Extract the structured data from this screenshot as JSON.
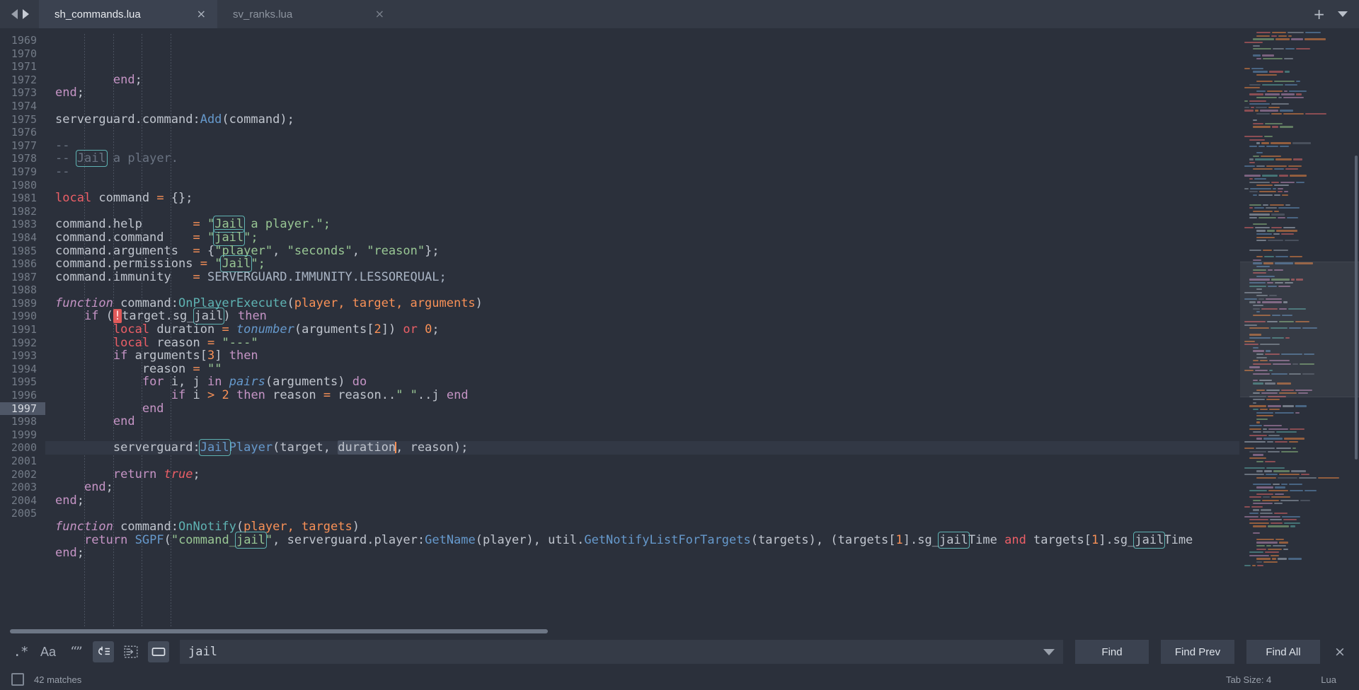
{
  "window": {
    "tabs": [
      {
        "label": "sh_commands.lua",
        "active": true,
        "close": "×"
      },
      {
        "label": "sv_ranks.lua",
        "active": false,
        "close": "×"
      }
    ],
    "nav_back": "nav-back",
    "nav_forward": "nav-forward",
    "new_tab": "+",
    "tab_menu": "tab-list-chevron"
  },
  "editor": {
    "first_line": 1969,
    "current_line": 1997,
    "lines": [
      {
        "n": 1969,
        "indent": 2,
        "tokens": [
          {
            "t": "        ",
            "c": "t-def"
          },
          {
            "t": "end",
            "c": "t-kw2"
          },
          {
            "t": ";",
            "c": "t-punc"
          }
        ]
      },
      {
        "n": 1970,
        "indent": 0,
        "tokens": [
          {
            "t": "end",
            "c": "t-kw2"
          },
          {
            "t": ";",
            "c": "t-punc"
          }
        ]
      },
      {
        "n": 1971,
        "indent": 0,
        "tokens": []
      },
      {
        "n": 1972,
        "indent": 0,
        "tokens": [
          {
            "t": "serverguard.command:",
            "c": "t-def"
          },
          {
            "t": "Add",
            "c": "t-fn2"
          },
          {
            "t": "(",
            "c": "t-punc"
          },
          {
            "t": "command",
            "c": "t-def"
          },
          {
            "t": ");",
            "c": "t-punc"
          }
        ]
      },
      {
        "n": 1973,
        "indent": 0,
        "tokens": []
      },
      {
        "n": 1974,
        "indent": 0,
        "tokens": [
          {
            "t": "--",
            "c": "t-com"
          }
        ]
      },
      {
        "n": 1975,
        "indent": 0,
        "tokens": [
          {
            "t": "-- ",
            "c": "t-com"
          },
          {
            "t": "Jail",
            "c": "t-com",
            "hit": true
          },
          {
            "t": " a player.",
            "c": "t-com"
          }
        ]
      },
      {
        "n": 1976,
        "indent": 0,
        "tokens": [
          {
            "t": "--",
            "c": "t-com"
          }
        ]
      },
      {
        "n": 1977,
        "indent": 0,
        "tokens": []
      },
      {
        "n": 1978,
        "indent": 0,
        "tokens": [
          {
            "t": "local",
            "c": "t-kw"
          },
          {
            "t": " command ",
            "c": "t-def"
          },
          {
            "t": "=",
            "c": "t-op"
          },
          {
            "t": " {};",
            "c": "t-punc"
          }
        ]
      },
      {
        "n": 1979,
        "indent": 0,
        "tokens": []
      },
      {
        "n": 1980,
        "indent": 0,
        "tokens": [
          {
            "t": "command.help       ",
            "c": "t-def"
          },
          {
            "t": "=",
            "c": "t-op"
          },
          {
            "t": " \"",
            "c": "t-str"
          },
          {
            "t": "Jail",
            "c": "t-str",
            "hit": true
          },
          {
            "t": " a player.\";",
            "c": "t-str"
          }
        ]
      },
      {
        "n": 1981,
        "indent": 0,
        "tokens": [
          {
            "t": "command.command    ",
            "c": "t-def"
          },
          {
            "t": "=",
            "c": "t-op"
          },
          {
            "t": " \"",
            "c": "t-str"
          },
          {
            "t": "jail",
            "c": "t-str",
            "hit": true
          },
          {
            "t": "\";",
            "c": "t-str"
          }
        ]
      },
      {
        "n": 1982,
        "indent": 0,
        "tokens": [
          {
            "t": "command.arguments  ",
            "c": "t-def"
          },
          {
            "t": "=",
            "c": "t-op"
          },
          {
            "t": " {",
            "c": "t-punc"
          },
          {
            "t": "\"player\"",
            "c": "t-str"
          },
          {
            "t": ", ",
            "c": "t-punc"
          },
          {
            "t": "\"seconds\"",
            "c": "t-str"
          },
          {
            "t": ", ",
            "c": "t-punc"
          },
          {
            "t": "\"reason\"",
            "c": "t-str"
          },
          {
            "t": "};",
            "c": "t-punc"
          }
        ]
      },
      {
        "n": 1983,
        "indent": 0,
        "tokens": [
          {
            "t": "command.permissions ",
            "c": "t-def"
          },
          {
            "t": "=",
            "c": "t-op"
          },
          {
            "t": " \"",
            "c": "t-str"
          },
          {
            "t": "Jail",
            "c": "t-str",
            "hit": true
          },
          {
            "t": "\";",
            "c": "t-str"
          }
        ]
      },
      {
        "n": 1984,
        "indent": 0,
        "tokens": [
          {
            "t": "command.immunity   ",
            "c": "t-def"
          },
          {
            "t": "=",
            "c": "t-op"
          },
          {
            "t": " SERVERGUARD.IMMUNITY.LESSOREQUAL;",
            "c": "t-up"
          }
        ]
      },
      {
        "n": 1985,
        "indent": 0,
        "tokens": []
      },
      {
        "n": 1986,
        "indent": 0,
        "tokens": [
          {
            "t": "function",
            "c": "t-itmag"
          },
          {
            "t": " command:",
            "c": "t-def"
          },
          {
            "t": "OnPlayerExecute",
            "c": "t-fn"
          },
          {
            "t": "(",
            "c": "t-punc"
          },
          {
            "t": "player, target, arguments",
            "c": "t-par"
          },
          {
            "t": ")",
            "c": "t-punc"
          }
        ]
      },
      {
        "n": 1987,
        "indent": 1,
        "tokens": [
          {
            "t": "    ",
            "c": "t-def"
          },
          {
            "t": "if",
            "c": "t-kw2"
          },
          {
            "t": " (",
            "c": "t-punc"
          },
          {
            "t": "!",
            "c": "t-def",
            "err": true
          },
          {
            "t": "target.sg_",
            "c": "t-def"
          },
          {
            "t": "jail",
            "c": "t-def",
            "hit": true
          },
          {
            "t": ") ",
            "c": "t-punc"
          },
          {
            "t": "then",
            "c": "t-kw2"
          }
        ]
      },
      {
        "n": 1988,
        "indent": 2,
        "tokens": [
          {
            "t": "        ",
            "c": "t-def"
          },
          {
            "t": "local",
            "c": "t-kw"
          },
          {
            "t": " duration ",
            "c": "t-def"
          },
          {
            "t": "=",
            "c": "t-op"
          },
          {
            "t": " ",
            "c": "t-def"
          },
          {
            "t": "tonumber",
            "c": "t-fnit"
          },
          {
            "t": "(",
            "c": "t-punc"
          },
          {
            "t": "arguments",
            "c": "t-def"
          },
          {
            "t": "[",
            "c": "t-punc"
          },
          {
            "t": "2",
            "c": "t-num"
          },
          {
            "t": "]) ",
            "c": "t-punc"
          },
          {
            "t": "or",
            "c": "t-kw"
          },
          {
            "t": " ",
            "c": "t-def"
          },
          {
            "t": "0",
            "c": "t-num"
          },
          {
            "t": ";",
            "c": "t-punc"
          }
        ]
      },
      {
        "n": 1989,
        "indent": 2,
        "tokens": [
          {
            "t": "        ",
            "c": "t-def"
          },
          {
            "t": "local",
            "c": "t-kw"
          },
          {
            "t": " reason ",
            "c": "t-def"
          },
          {
            "t": "=",
            "c": "t-op"
          },
          {
            "t": " \"---\"",
            "c": "t-str"
          }
        ]
      },
      {
        "n": 1990,
        "indent": 2,
        "tokens": [
          {
            "t": "        ",
            "c": "t-def"
          },
          {
            "t": "if",
            "c": "t-kw2"
          },
          {
            "t": " arguments",
            "c": "t-def"
          },
          {
            "t": "[",
            "c": "t-punc"
          },
          {
            "t": "3",
            "c": "t-num"
          },
          {
            "t": "] ",
            "c": "t-punc"
          },
          {
            "t": "then",
            "c": "t-kw2"
          }
        ]
      },
      {
        "n": 1991,
        "indent": 3,
        "tokens": [
          {
            "t": "            reason ",
            "c": "t-def"
          },
          {
            "t": "=",
            "c": "t-op"
          },
          {
            "t": " \"\"",
            "c": "t-str"
          }
        ]
      },
      {
        "n": 1992,
        "indent": 3,
        "tokens": [
          {
            "t": "            ",
            "c": "t-def"
          },
          {
            "t": "for",
            "c": "t-kw2"
          },
          {
            "t": " i, j ",
            "c": "t-def"
          },
          {
            "t": "in",
            "c": "t-kw2"
          },
          {
            "t": " ",
            "c": "t-def"
          },
          {
            "t": "pairs",
            "c": "t-fnit"
          },
          {
            "t": "(",
            "c": "t-punc"
          },
          {
            "t": "arguments",
            "c": "t-def"
          },
          {
            "t": ") ",
            "c": "t-punc"
          },
          {
            "t": "do",
            "c": "t-kw2"
          }
        ]
      },
      {
        "n": 1993,
        "indent": 4,
        "tokens": [
          {
            "t": "                ",
            "c": "t-def"
          },
          {
            "t": "if",
            "c": "t-kw2"
          },
          {
            "t": " i ",
            "c": "t-def"
          },
          {
            "t": ">",
            "c": "t-op"
          },
          {
            "t": " ",
            "c": "t-def"
          },
          {
            "t": "2",
            "c": "t-num"
          },
          {
            "t": " ",
            "c": "t-def"
          },
          {
            "t": "then",
            "c": "t-kw2"
          },
          {
            "t": " reason ",
            "c": "t-def"
          },
          {
            "t": "=",
            "c": "t-op"
          },
          {
            "t": " reason..",
            "c": "t-def"
          },
          {
            "t": "\" \"",
            "c": "t-str"
          },
          {
            "t": "..j ",
            "c": "t-def"
          },
          {
            "t": "end",
            "c": "t-kw2"
          }
        ]
      },
      {
        "n": 1994,
        "indent": 3,
        "tokens": [
          {
            "t": "            ",
            "c": "t-def"
          },
          {
            "t": "end",
            "c": "t-kw2"
          }
        ]
      },
      {
        "n": 1995,
        "indent": 2,
        "tokens": [
          {
            "t": "        ",
            "c": "t-def"
          },
          {
            "t": "end",
            "c": "t-kw2"
          }
        ]
      },
      {
        "n": 1996,
        "indent": 2,
        "tokens": []
      },
      {
        "n": 1997,
        "indent": 2,
        "current": true,
        "tokens": [
          {
            "t": "        serverguard:",
            "c": "t-def"
          },
          {
            "t": "Jail",
            "c": "t-fn2",
            "hit": true
          },
          {
            "t": "Player",
            "c": "t-fn2"
          },
          {
            "t": "(",
            "c": "t-punc"
          },
          {
            "t": "target, ",
            "c": "t-def"
          },
          {
            "t": "duration",
            "c": "t-def",
            "sel": true
          },
          {
            "t": "",
            "c": "t-def",
            "caret": true
          },
          {
            "t": ", reason);",
            "c": "t-def"
          }
        ]
      },
      {
        "n": 1998,
        "indent": 2,
        "tokens": []
      },
      {
        "n": 1999,
        "indent": 2,
        "tokens": [
          {
            "t": "        ",
            "c": "t-def"
          },
          {
            "t": "return",
            "c": "t-kw2"
          },
          {
            "t": " ",
            "c": "t-def"
          },
          {
            "t": "true",
            "c": "t-const"
          },
          {
            "t": ";",
            "c": "t-punc"
          }
        ]
      },
      {
        "n": 2000,
        "indent": 1,
        "tokens": [
          {
            "t": "    ",
            "c": "t-def"
          },
          {
            "t": "end",
            "c": "t-kw2"
          },
          {
            "t": ";",
            "c": "t-punc"
          }
        ]
      },
      {
        "n": 2001,
        "indent": 0,
        "tokens": [
          {
            "t": "end",
            "c": "t-kw2"
          },
          {
            "t": ";",
            "c": "t-punc"
          }
        ]
      },
      {
        "n": 2002,
        "indent": 0,
        "tokens": []
      },
      {
        "n": 2003,
        "indent": 0,
        "tokens": [
          {
            "t": "function",
            "c": "t-itmag"
          },
          {
            "t": " command:",
            "c": "t-def"
          },
          {
            "t": "OnNotify",
            "c": "t-fn"
          },
          {
            "t": "(",
            "c": "t-punc"
          },
          {
            "t": "player, targets",
            "c": "t-par"
          },
          {
            "t": ")",
            "c": "t-punc"
          }
        ]
      },
      {
        "n": 2004,
        "indent": 1,
        "tokens": [
          {
            "t": "    ",
            "c": "t-def"
          },
          {
            "t": "return",
            "c": "t-kw2"
          },
          {
            "t": " ",
            "c": "t-def"
          },
          {
            "t": "SGPF",
            "c": "t-fn2"
          },
          {
            "t": "(",
            "c": "t-punc"
          },
          {
            "t": "\"command_",
            "c": "t-str"
          },
          {
            "t": "jail",
            "c": "t-str",
            "hit": true
          },
          {
            "t": "\"",
            "c": "t-str"
          },
          {
            "t": ", ",
            "c": "t-punc"
          },
          {
            "t": "serverguard.player:",
            "c": "t-def"
          },
          {
            "t": "GetName",
            "c": "t-fn2"
          },
          {
            "t": "(",
            "c": "t-punc"
          },
          {
            "t": "player",
            "c": "t-def"
          },
          {
            "t": "), ",
            "c": "t-punc"
          },
          {
            "t": "util.",
            "c": "t-def"
          },
          {
            "t": "GetNotifyListForTargets",
            "c": "t-fn2"
          },
          {
            "t": "(",
            "c": "t-punc"
          },
          {
            "t": "targets",
            "c": "t-def"
          },
          {
            "t": "), (",
            "c": "t-punc"
          },
          {
            "t": "targets",
            "c": "t-def"
          },
          {
            "t": "[",
            "c": "t-punc"
          },
          {
            "t": "1",
            "c": "t-num"
          },
          {
            "t": "].sg_",
            "c": "t-def"
          },
          {
            "t": "jail",
            "c": "t-def",
            "hit": true
          },
          {
            "t": "Time ",
            "c": "t-def"
          },
          {
            "t": "and",
            "c": "t-kw"
          },
          {
            "t": " targets",
            "c": "t-def"
          },
          {
            "t": "[",
            "c": "t-punc"
          },
          {
            "t": "1",
            "c": "t-num"
          },
          {
            "t": "].sg_",
            "c": "t-def"
          },
          {
            "t": "jail",
            "c": "t-def",
            "hit": true
          },
          {
            "t": "Time",
            "c": "t-def"
          }
        ]
      },
      {
        "n": 2005,
        "indent": 0,
        "tokens": [
          {
            "t": "end",
            "c": "t-kw2"
          },
          {
            "t": ";",
            "c": "t-punc"
          }
        ]
      }
    ]
  },
  "findbar": {
    "regex_label": ".*",
    "case_label": "Aa",
    "word_label": "“”",
    "wrap_icon": "wrap-around-icon",
    "insel_icon": "in-selection-icon",
    "highlight_icon": "highlight-results-icon",
    "query": "jail",
    "placeholder": "Find",
    "dropdown_icon": "history-chevron-down-icon",
    "find_label": "Find",
    "find_prev_label": "Find Prev",
    "find_all_label": "Find All",
    "close_label": "×",
    "toggles": {
      "regex": false,
      "case": false,
      "word": false,
      "wrap": true,
      "in_selection": false,
      "highlight": true
    }
  },
  "statusbar": {
    "matches": "42 matches",
    "tab_size": "Tab Size: 4",
    "language": "Lua",
    "panel_icon": "side-panel-icon"
  },
  "colors": {
    "bg": "#2b303b",
    "chrome": "#343a46",
    "active_tab": "#3b4250",
    "accent_teal": "#5fb3b3",
    "string": "#99c794",
    "keyword": "#ec5f67",
    "number": "#f99157",
    "function": "#6699cc",
    "comment": "#6a7382",
    "error_hl": "#e05a5a",
    "caret": "#f99157"
  }
}
